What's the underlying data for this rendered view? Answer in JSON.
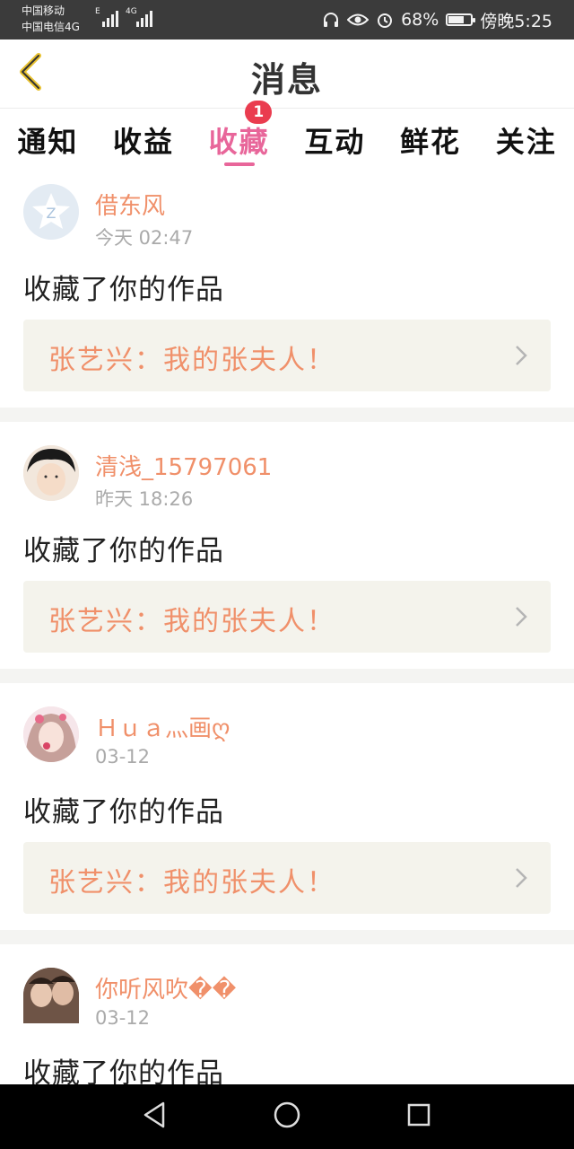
{
  "status_bar": {
    "carrier_1": "中国移动",
    "carrier_2": "中国电信4G",
    "net_1": "E",
    "net_2": "4G",
    "battery": "68%",
    "time": "傍晚5:25",
    "battery_level": 0.68
  },
  "header": {
    "title": "消息"
  },
  "tabs": [
    {
      "label": "通知"
    },
    {
      "label": "收益"
    },
    {
      "label": "收藏",
      "active": true,
      "badge": "1"
    },
    {
      "label": "互动"
    },
    {
      "label": "鲜花"
    },
    {
      "label": "关注"
    }
  ],
  "messages": [
    {
      "username": "借东风",
      "time": "今天 02:47",
      "action": "收藏了你的作品",
      "work_title": "张艺兴：我的张夫人！"
    },
    {
      "username": "清浅_15797061",
      "time": "昨天 18:26",
      "action": "收藏了你的作品",
      "work_title": "张艺兴：我的张夫人！"
    },
    {
      "username": "Ｈｕａ灬画ღ",
      "time": "03-12",
      "action": "收藏了你的作品",
      "work_title": "张艺兴：我的张夫人！"
    },
    {
      "username": "你听风吹��",
      "time": "03-12",
      "action": "收藏了你的作品"
    }
  ],
  "colors": {
    "accent": "#e8669a",
    "username": "#f0906a",
    "badge": "#ea3c4f",
    "card_bg": "#f4f3ec"
  }
}
